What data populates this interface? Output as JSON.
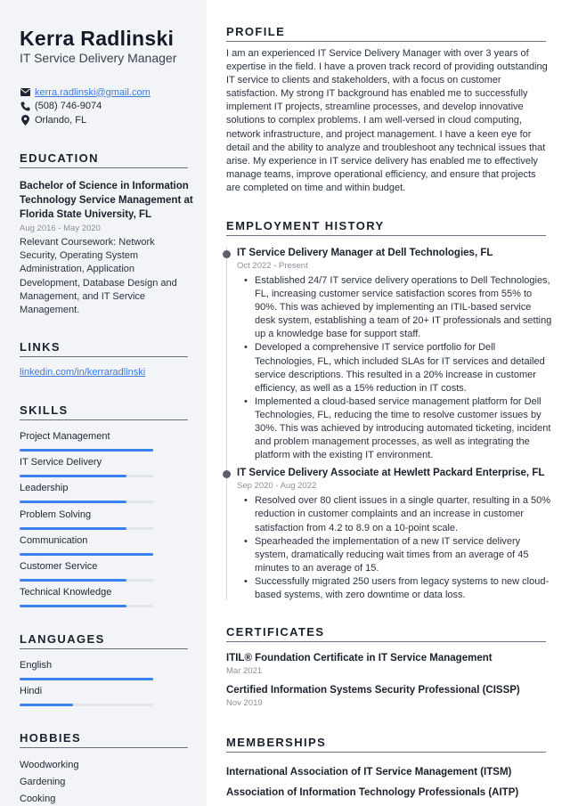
{
  "header": {
    "name": "Kerra Radlinski",
    "title": "IT Service Delivery Manager"
  },
  "contact": {
    "email": "kerra.radlinski@gmail.com",
    "phone": "(508) 746-9074",
    "location": "Orlando, FL",
    "icons": [
      "envelope-icon",
      "phone-icon",
      "map-pin-icon"
    ]
  },
  "education": {
    "heading": "EDUCATION",
    "degree": "Bachelor of Science in Information Technology Service Management at Florida State University, FL",
    "dates": "Aug 2016 - May 2020",
    "description": "Relevant Coursework: Network Security, Operating System Administration, Application Development, Database Design and Management, and IT Service Management."
  },
  "links": {
    "heading": "LINKS",
    "items": [
      "linkedin.com/in/kerraradlinski"
    ]
  },
  "skills": {
    "heading": "SKILLS",
    "items": [
      {
        "label": "Project Management",
        "level": 1.0
      },
      {
        "label": "IT Service Delivery",
        "level": 0.8
      },
      {
        "label": "Leadership",
        "level": 0.8
      },
      {
        "label": "Problem Solving",
        "level": 0.8
      },
      {
        "label": "Communication",
        "level": 1.0
      },
      {
        "label": "Customer Service",
        "level": 0.8
      },
      {
        "label": "Technical Knowledge",
        "level": 0.8
      }
    ]
  },
  "languages": {
    "heading": "LANGUAGES",
    "items": [
      {
        "label": "English",
        "level": 1.0
      },
      {
        "label": "Hindi",
        "level": 0.4
      }
    ]
  },
  "hobbies": {
    "heading": "HOBBIES",
    "items": [
      "Woodworking",
      "Gardening",
      "Cooking"
    ]
  },
  "profile": {
    "heading": "PROFILE",
    "text": "I am an experienced IT Service Delivery Manager with over 3 years of expertise in the field. I have a proven track record of providing outstanding IT service to clients and stakeholders, with a focus on customer satisfaction. My strong IT background has enabled me to successfully implement IT projects, streamline processes, and develop innovative solutions to complex problems. I am well-versed in cloud computing, network infrastructure, and project management. I have a keen eye for detail and the ability to analyze and troubleshoot any technical issues that arise. My experience in IT service delivery has enabled me to effectively manage teams, improve operational efficiency, and ensure that projects are completed on time and within budget."
  },
  "employment": {
    "heading": "EMPLOYMENT HISTORY",
    "jobs": [
      {
        "title": "IT Service Delivery Manager at Dell Technologies, FL",
        "dates": "Oct 2022 - Present",
        "bullets": [
          "Established 24/7 IT service delivery operations to Dell Technologies, FL, increasing customer service satisfaction scores from 55% to 90%. This was achieved by implementing an ITIL-based service desk system, establishing a team of 20+ IT professionals and setting up a knowledge base for support staff.",
          "Developed a comprehensive IT service portfolio for Dell Technologies, FL, which included SLAs for IT services and detailed service descriptions. This resulted in a 20% increase in customer efficiency, as well as a 15% reduction in IT costs.",
          "Implemented a cloud-based service management platform for Dell Technologies, FL, reducing the time to resolve customer issues by 30%. This was achieved by introducing automated ticketing, incident and problem management processes, as well as integrating the platform with the existing IT environment."
        ]
      },
      {
        "title": "IT Service Delivery Associate at Hewlett Packard Enterprise, FL",
        "dates": "Sep 2020 - Aug 2022",
        "bullets": [
          "Resolved over 80 client issues in a single quarter, resulting in a 50% reduction in customer complaints and an increase in customer satisfaction from 4.2 to 8.9 on a 10-point scale.",
          "Spearheaded the implementation of a new IT service delivery system, dramatically reducing wait times from an average of 45 minutes to an average of 15.",
          "Successfully migrated 250 users from legacy systems to new cloud-based systems, with zero downtime or data loss."
        ]
      }
    ]
  },
  "certificates": {
    "heading": "CERTIFICATES",
    "items": [
      {
        "name": "ITIL® Foundation Certificate in IT Service Management",
        "date": "Mar 2021"
      },
      {
        "name": "Certified Information Systems Security Professional (CISSP)",
        "date": "Nov 2019"
      }
    ]
  },
  "memberships": {
    "heading": "MEMBERSHIPS",
    "items": [
      "International Association of IT Service Management (ITSM)",
      "Association of Information Technology Professionals (AITP)"
    ]
  },
  "colors": {
    "accent": "#3b82f0",
    "link": "#3a7be0",
    "sidebar_bg": "#f2f4f8",
    "muted": "#8a8f99"
  }
}
